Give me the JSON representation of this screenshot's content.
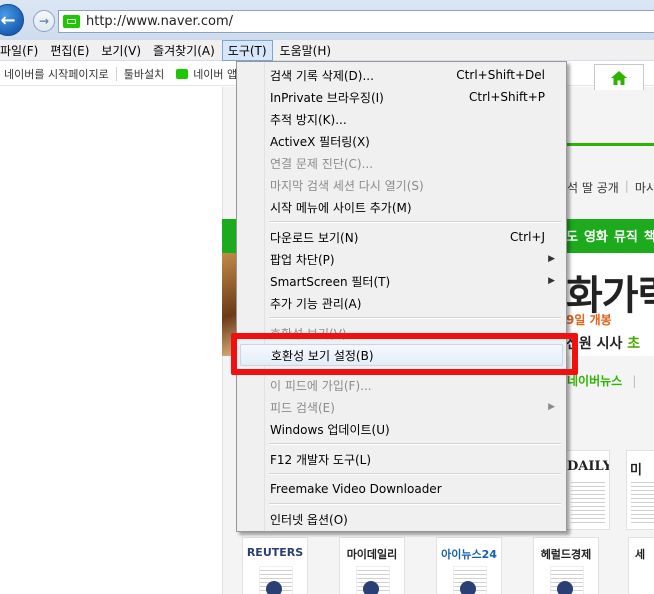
{
  "browser": {
    "url": "http://www.naver.com/",
    "back_glyph": "←",
    "forward_glyph": "→"
  },
  "menubar": [
    {
      "label": "파일(F)"
    },
    {
      "label": "편집(E)"
    },
    {
      "label": "보기(V)"
    },
    {
      "label": "즐겨찾기(A)"
    },
    {
      "label": "도구(T)"
    },
    {
      "label": "도움말(H)"
    }
  ],
  "favorites": {
    "items": [
      "네이버를 시작페이지로",
      "툴바설치",
      "네이버 앱"
    ]
  },
  "tools_menu": {
    "items": [
      {
        "label": "검색 기록 삭제(D)...",
        "shortcut": "Ctrl+Shift+Del"
      },
      {
        "label": "InPrivate 브라우징(I)",
        "shortcut": "Ctrl+Shift+P"
      },
      {
        "label": "추적 방지(K)..."
      },
      {
        "label": "ActiveX 필터링(X)"
      },
      {
        "label": "연결 문제 진단(C)..."
      },
      {
        "label": "마지막 검색 세션 다시 열기(S)"
      },
      {
        "label": "시작 메뉴에 사이트 추가(M)"
      },
      {
        "label": "다운로드 보기(N)",
        "shortcut": "Ctrl+J"
      },
      {
        "label": "팝업 차단(P)"
      },
      {
        "label": "SmartScreen 필터(T)"
      },
      {
        "label": "추가 기능 관리(A)"
      },
      {
        "label": "호환성 보기(V)"
      },
      {
        "label": "호환성 보기 설정(B)"
      },
      {
        "label": "이 피드에 가입(F)..."
      },
      {
        "label": "피드 검색(E)"
      },
      {
        "label": "Windows 업데이트(U)"
      },
      {
        "label": "F12 개발자 도구(L)"
      },
      {
        "label": "Freemake Video Downloader"
      },
      {
        "label": "인터넷 옵션(O)"
      }
    ],
    "submenu_arrow": "▶"
  },
  "page": {
    "secondary_links": [
      "석 딸 공개",
      "마시"
    ],
    "gnb_items": [
      "도",
      "영화",
      "뮤직",
      "책"
    ],
    "banner": {
      "headline": "화가럭",
      "opening": "9일 개봉",
      "subline_prefix": "전원 시사",
      "subline_highlight": "초"
    },
    "news_label": "네이버뉴스",
    "news_sep": "|",
    "news_cards": [
      "REUTERS",
      "마이데일리",
      "아이뉴스24",
      "헤럴드경제",
      "세"
    ],
    "daily_logo": "DAILY",
    "mi_logo": "미"
  }
}
